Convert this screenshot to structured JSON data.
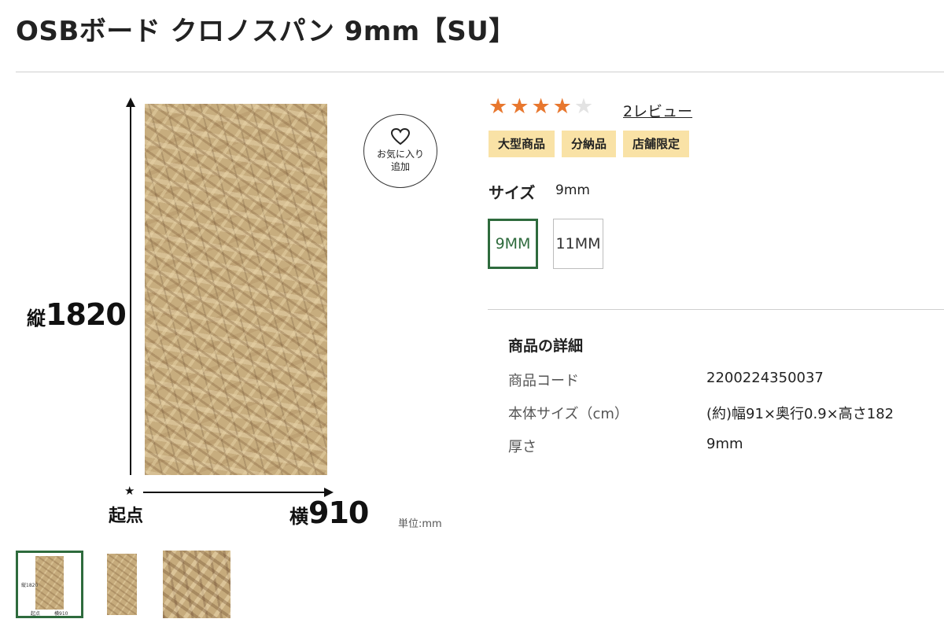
{
  "product": {
    "title": "OSBボード クロノスパン 9mm【SU】"
  },
  "image": {
    "dimension_vertical_prefix": "縦",
    "dimension_vertical_value": "1820",
    "dimension_horizontal_prefix": "横",
    "dimension_horizontal_value": "910",
    "origin_label": "起点",
    "origin_marker": "★",
    "unit_label": "単位:mm",
    "thumb_small_vertical": "縦1820",
    "thumb_small_origin": "起点",
    "thumb_small_horizontal": "横910"
  },
  "favorite": {
    "line1": "お気に入り",
    "line2": "追加",
    "icon": "heart-outline"
  },
  "rating": {
    "value": 4,
    "max": 5,
    "filled_color": "#e8772e",
    "empty_color": "#e3e3e3",
    "review_link": "2レビュー"
  },
  "badges": [
    "大型商品",
    "分納品",
    "店舗限定"
  ],
  "size": {
    "label": "サイズ",
    "selected_value": "9mm",
    "options": [
      "9MM",
      "11MM"
    ],
    "selected_index": 0
  },
  "details": {
    "title": "商品の詳細",
    "rows": [
      {
        "key": "商品コード",
        "value": "2200224350037"
      },
      {
        "key": "本体サイズ（cm）",
        "value": "(約)幅91×奥行0.9×高さ182"
      },
      {
        "key": "厚さ",
        "value": "9mm"
      }
    ]
  },
  "colors": {
    "accent_green": "#2e6b3d",
    "badge_bg": "#f9e2a6"
  }
}
